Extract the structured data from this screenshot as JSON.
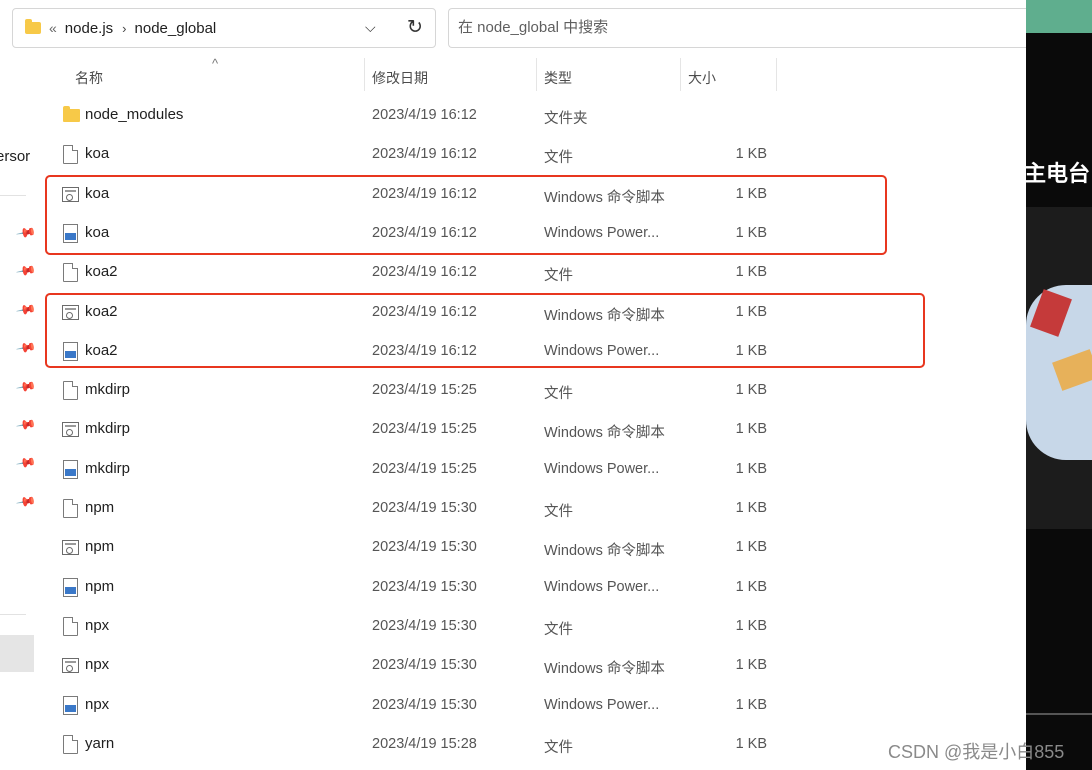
{
  "address_bar": {
    "overflow_glyph": "«",
    "crumbs": [
      "node.js",
      "node_global"
    ],
    "separator": "›",
    "dropdown_glyph": "⌵",
    "refresh_glyph": "↻"
  },
  "search": {
    "placeholder": "在 node_global 中搜索"
  },
  "nav_pane": {
    "partial_label": "ersor",
    "pin_glyph": "📌"
  },
  "columns": {
    "name": "名称",
    "modified": "修改日期",
    "type": "类型",
    "size": "大小",
    "sort_glyph": "^"
  },
  "files": [
    {
      "name": "node_modules",
      "modified": "2023/4/19 16:12",
      "type": "文件夹",
      "size": "",
      "icon": "folder-icon"
    },
    {
      "name": "koa",
      "modified": "2023/4/19 16:12",
      "type": "文件",
      "size": "1 KB",
      "icon": "file-icon"
    },
    {
      "name": "koa",
      "modified": "2023/4/19 16:12",
      "type": "Windows 命令脚本",
      "size": "1 KB",
      "icon": "cmd-script-icon"
    },
    {
      "name": "koa",
      "modified": "2023/4/19 16:12",
      "type": "Windows Power...",
      "size": "1 KB",
      "icon": "powershell-script-icon"
    },
    {
      "name": "koa2",
      "modified": "2023/4/19 16:12",
      "type": "文件",
      "size": "1 KB",
      "icon": "file-icon"
    },
    {
      "name": "koa2",
      "modified": "2023/4/19 16:12",
      "type": "Windows 命令脚本",
      "size": "1 KB",
      "icon": "cmd-script-icon"
    },
    {
      "name": "koa2",
      "modified": "2023/4/19 16:12",
      "type": "Windows Power...",
      "size": "1 KB",
      "icon": "powershell-script-icon"
    },
    {
      "name": "mkdirp",
      "modified": "2023/4/19 15:25",
      "type": "文件",
      "size": "1 KB",
      "icon": "file-icon"
    },
    {
      "name": "mkdirp",
      "modified": "2023/4/19 15:25",
      "type": "Windows 命令脚本",
      "size": "1 KB",
      "icon": "cmd-script-icon"
    },
    {
      "name": "mkdirp",
      "modified": "2023/4/19 15:25",
      "type": "Windows Power...",
      "size": "1 KB",
      "icon": "powershell-script-icon"
    },
    {
      "name": "npm",
      "modified": "2023/4/19 15:30",
      "type": "文件",
      "size": "1 KB",
      "icon": "file-icon"
    },
    {
      "name": "npm",
      "modified": "2023/4/19 15:30",
      "type": "Windows 命令脚本",
      "size": "1 KB",
      "icon": "cmd-script-icon"
    },
    {
      "name": "npm",
      "modified": "2023/4/19 15:30",
      "type": "Windows Power...",
      "size": "1 KB",
      "icon": "powershell-script-icon"
    },
    {
      "name": "npx",
      "modified": "2023/4/19 15:30",
      "type": "文件",
      "size": "1 KB",
      "icon": "file-icon"
    },
    {
      "name": "npx",
      "modified": "2023/4/19 15:30",
      "type": "Windows 命令脚本",
      "size": "1 KB",
      "icon": "cmd-script-icon"
    },
    {
      "name": "npx",
      "modified": "2023/4/19 15:30",
      "type": "Windows Power...",
      "size": "1 KB",
      "icon": "powershell-script-icon"
    },
    {
      "name": "yarn",
      "modified": "2023/4/19 15:28",
      "type": "文件",
      "size": "1 KB",
      "icon": "file-icon"
    }
  ],
  "background_app": {
    "title_fragment": "主电台"
  },
  "watermark": "CSDN @我是小白855",
  "colors": {
    "highlight": "#e8361f",
    "folder": "#f7c948",
    "powershell": "#3a78c8"
  }
}
